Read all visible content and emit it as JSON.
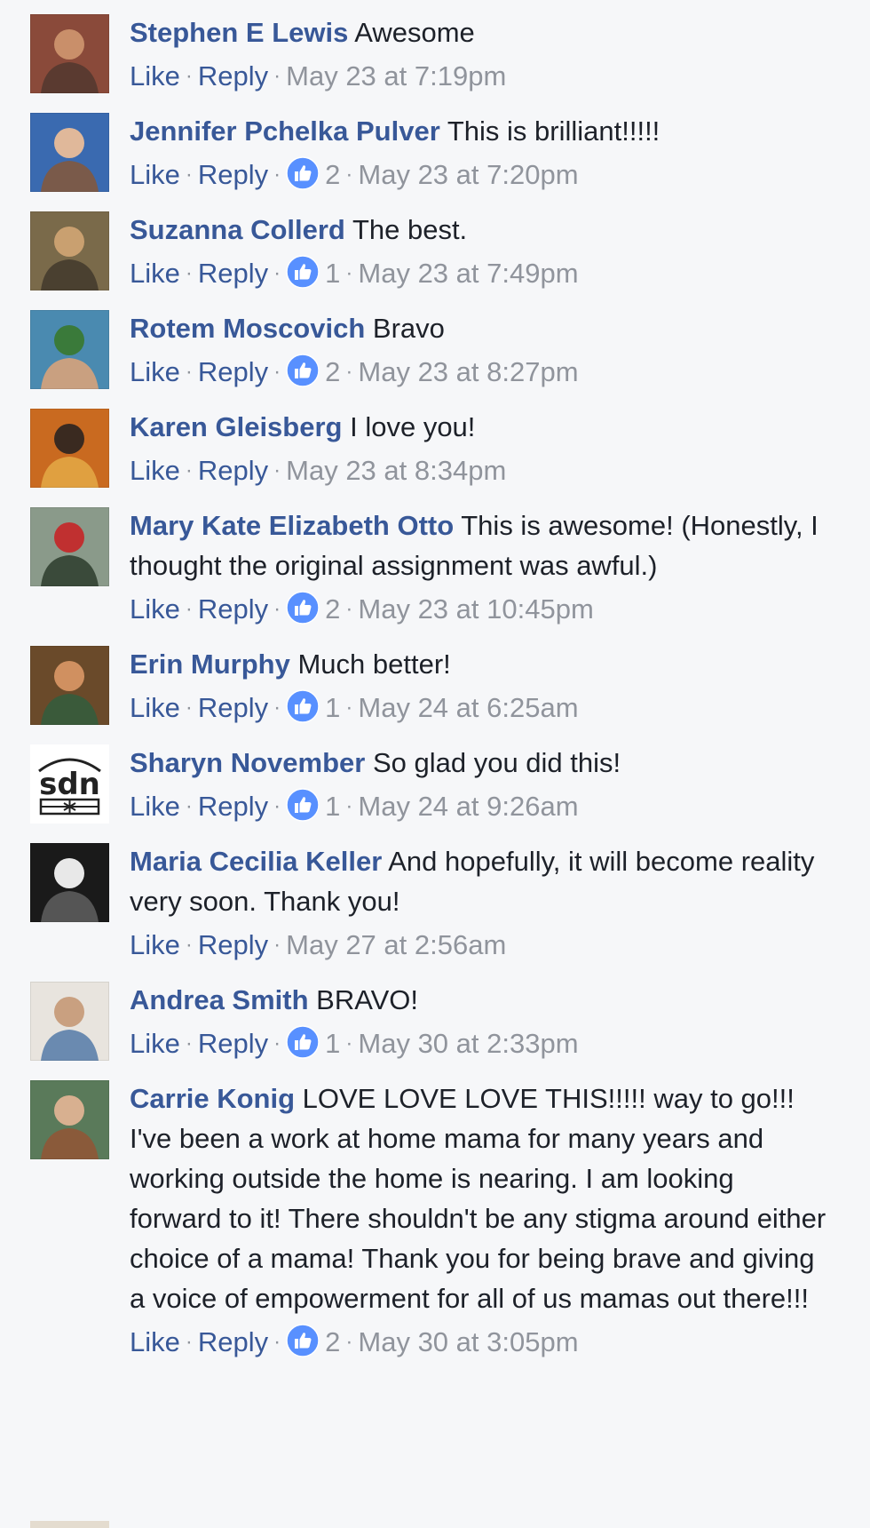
{
  "actions": {
    "like": "Like",
    "reply": "Reply",
    "separator": "·"
  },
  "colors": {
    "background": "#f6f7f9",
    "author_link": "#385898",
    "meta_gray": "#90949c",
    "reaction_blue": "#5890ff"
  },
  "icons": {
    "reaction": "like-thumbs-up-icon"
  },
  "comments": [
    {
      "author": "Stephen E Lewis",
      "text": "Awesome",
      "likes": "",
      "timestamp": "May 23 at 7:19pm"
    },
    {
      "author": "Jennifer Pchelka Pulver",
      "text": "This is brilliant!!!!!",
      "likes": "2",
      "timestamp": "May 23 at 7:20pm"
    },
    {
      "author": "Suzanna Collerd",
      "text": "The best.",
      "likes": "1",
      "timestamp": "May 23 at 7:49pm"
    },
    {
      "author": "Rotem Moscovich",
      "text": "Bravo",
      "likes": "2",
      "timestamp": "May 23 at 8:27pm"
    },
    {
      "author": "Karen Gleisberg",
      "text": "I love you!",
      "likes": "",
      "timestamp": "May 23 at 8:34pm"
    },
    {
      "author": "Mary Kate Elizabeth Otto",
      "text": "This is awesome! (Honestly, I thought the original assignment was awful.)",
      "likes": "2",
      "timestamp": "May 23 at 10:45pm"
    },
    {
      "author": "Erin Murphy",
      "text": "Much better!",
      "likes": "1",
      "timestamp": "May 24 at 6:25am"
    },
    {
      "author": "Sharyn November",
      "text": "So glad you did this!",
      "likes": "1",
      "timestamp": "May 24 at 9:26am",
      "avatar_logo_text": "sdn"
    },
    {
      "author": "Maria Cecilia Keller",
      "text": "And hopefully, it will become reality very soon. Thank you!",
      "likes": "",
      "timestamp": "May 27 at 2:56am"
    },
    {
      "author": "Andrea Smith",
      "text": "BRAVO!",
      "likes": "1",
      "timestamp": "May 30 at 2:33pm"
    },
    {
      "author": "Carrie Konig",
      "text": "LOVE LOVE LOVE THIS!!!!! way to go!!! I've been a work at home mama for many years and working outside the home is nearing. I am looking forward to it! There shouldn't be any stigma around either choice of a mama! Thank you for being brave and giving a voice of empowerment for all of us mamas out there!!!",
      "likes": "2",
      "timestamp": "May 30 at 3:05pm"
    }
  ]
}
